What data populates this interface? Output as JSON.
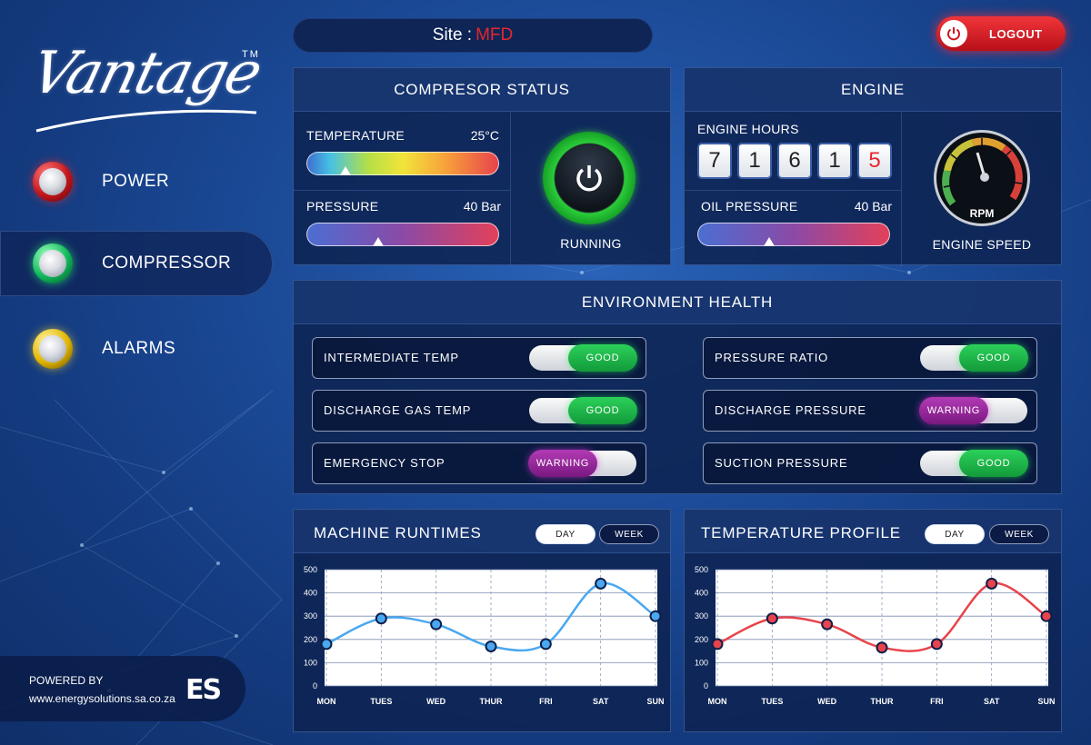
{
  "brand": {
    "logo": "Vantage",
    "tm": "TM"
  },
  "site": {
    "label": "Site :",
    "value": "MFD"
  },
  "logout": {
    "label": "LOGOUT"
  },
  "nav": {
    "items": [
      {
        "label": "POWER",
        "color": "red"
      },
      {
        "label": "COMPRESSOR",
        "color": "green",
        "active": true
      },
      {
        "label": "ALARMS",
        "color": "yellow"
      }
    ]
  },
  "powered": {
    "line1": "POWERED BY",
    "line2": "www.energysolutions.sa.co.za",
    "logo": "ES"
  },
  "compressor": {
    "title": "COMPRESOR STATUS",
    "temperature": {
      "label": "TEMPERATURE",
      "value": "25°C",
      "level": 0.2
    },
    "pressure": {
      "label": "PRESSURE",
      "value": "40 Bar",
      "level": 0.37
    },
    "status": "RUNNING"
  },
  "engine": {
    "title": "ENGINE",
    "hours_label": "ENGINE HOURS",
    "digits": [
      "7",
      "1",
      "6",
      "1",
      "5"
    ],
    "oil": {
      "label": "OIL PRESSURE",
      "value": "40 Bar",
      "level": 0.37
    },
    "gauge_label": "RPM",
    "speed_label": "ENGINE SPEED"
  },
  "health": {
    "title": "ENVIRONMENT HEALTH",
    "rows": [
      {
        "label": "INTERMEDIATE TEMP",
        "status": "GOOD"
      },
      {
        "label": "PRESSURE RATIO",
        "status": "GOOD"
      },
      {
        "label": "DISCHARGE GAS TEMP",
        "status": "GOOD"
      },
      {
        "label": "DISCHARGE PRESSURE",
        "status": "WARNING"
      },
      {
        "label": "EMERGENCY STOP",
        "status": "WARNING"
      },
      {
        "label": "SUCTION PRESSURE",
        "status": "GOOD"
      }
    ]
  },
  "runtimes": {
    "title": "MACHINE RUNTIMES",
    "day": "DAY",
    "week": "WEEK"
  },
  "tempprofile": {
    "title": "TEMPERATURE PROFILE",
    "day": "DAY",
    "week": "WEEK"
  },
  "colors": {
    "accent_red": "#e8262e",
    "good": "#1fbf4c",
    "warning": "#9a2aa0",
    "line_blue": "#4aa8f0",
    "line_red": "#e8434b"
  },
  "chart_data": [
    {
      "type": "line",
      "title": "MACHINE RUNTIMES",
      "categories": [
        "MON",
        "TUES",
        "WED",
        "THUR",
        "FRI",
        "SAT",
        "SUN"
      ],
      "series": [
        {
          "values": [
            180,
            290,
            265,
            170,
            180,
            440,
            300
          ]
        }
      ],
      "yticks": [
        0,
        100,
        200,
        300,
        400,
        500
      ],
      "ylim": [
        0,
        500
      ],
      "grid": true
    },
    {
      "type": "line",
      "title": "TEMPERATURE PROFILE",
      "categories": [
        "MON",
        "TUES",
        "WED",
        "THUR",
        "FRI",
        "SAT",
        "SUN"
      ],
      "series": [
        {
          "values": [
            180,
            290,
            265,
            165,
            180,
            440,
            300
          ]
        }
      ],
      "yticks": [
        0,
        100,
        200,
        300,
        400,
        500
      ],
      "ylim": [
        0,
        500
      ],
      "grid": true
    }
  ]
}
